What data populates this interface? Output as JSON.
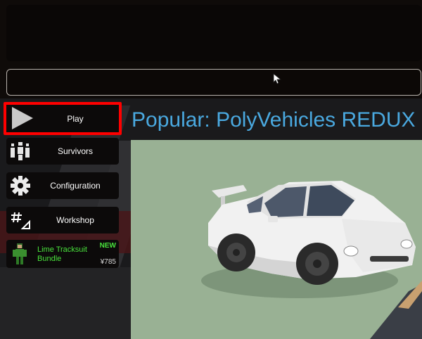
{
  "menu": {
    "play_label": "Play",
    "survivors_label": "Survivors",
    "configuration_label": "Configuration",
    "workshop_label": "Workshop"
  },
  "promo": {
    "name": "Lime Tracksuit Bundle",
    "badge": "NEW",
    "price": "¥785"
  },
  "content": {
    "title": "Popular: PolyVehicles REDUX"
  },
  "colors": {
    "accent_blue": "#4aa9e0",
    "highlight_red": "#ff0000",
    "promo_green": "#49e23c",
    "preview_bg": "#99b194"
  },
  "icons": [
    "play-icon",
    "survivors-icon",
    "gear-icon",
    "workshop-icon",
    "cursor-icon"
  ]
}
